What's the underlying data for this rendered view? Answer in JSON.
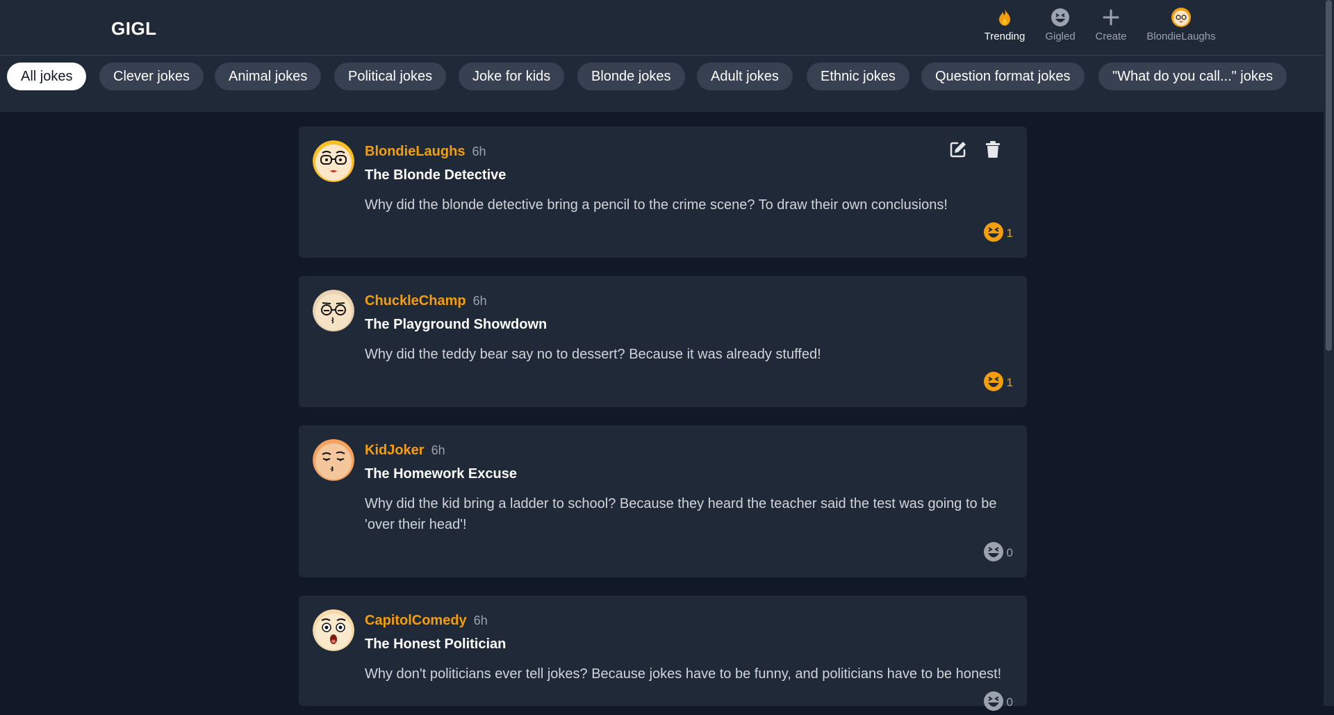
{
  "app": {
    "logo": "GIGL"
  },
  "nav": [
    {
      "label": "Trending",
      "icon": "flame-icon",
      "active": true
    },
    {
      "label": "Gigled",
      "icon": "laugh-face-icon",
      "active": false
    },
    {
      "label": "Create",
      "icon": "plus-icon",
      "active": false
    },
    {
      "label": "BlondieLaughs",
      "icon": "user-avatar-icon",
      "active": false
    }
  ],
  "filters": [
    {
      "label": "All jokes",
      "active": true
    },
    {
      "label": "Clever jokes"
    },
    {
      "label": "Animal jokes"
    },
    {
      "label": "Political jokes"
    },
    {
      "label": "Joke for kids"
    },
    {
      "label": "Blonde jokes"
    },
    {
      "label": "Adult jokes"
    },
    {
      "label": "Ethnic jokes"
    },
    {
      "label": "Question format jokes"
    },
    {
      "label": "\"What do you call...\" jokes"
    }
  ],
  "posts": [
    {
      "author": "BlondieLaughs",
      "time": "6h",
      "title": "The Blonde Detective",
      "body": "Why did the blonde detective bring a pencil to the crime scene? To draw their own conclusions!",
      "gigls": "1",
      "reacted": true,
      "owned": true,
      "avatar_icon": "woman-glasses-avatar-icon"
    },
    {
      "author": "ChuckleChamp",
      "time": "6h",
      "title": "The Playground Showdown",
      "body": "Why did the teddy bear say no to dessert? Because it was already stuffed!",
      "gigls": "1",
      "reacted": true,
      "owned": false,
      "avatar_icon": "man-glasses-avatar-icon"
    },
    {
      "author": "KidJoker",
      "time": "6h",
      "title": "The Homework Excuse",
      "body": "Why did the kid bring a ladder to school? Because they heard the teacher said the test was going to be 'over their head'!",
      "gigls": "0",
      "reacted": false,
      "owned": false,
      "avatar_icon": "smirk-avatar-icon"
    },
    {
      "author": "CapitolComedy",
      "time": "6h",
      "title": "The Honest Politician",
      "body": "Why don't politicians ever tell jokes? Because jokes have to be funny, and politicians have to be honest!",
      "gigls": "0",
      "reacted": false,
      "owned": false,
      "avatar_icon": "surprised-avatar-icon"
    }
  ],
  "colors": {
    "accent": "#f59e0b",
    "background": "#111827",
    "surface": "#1f2937",
    "chip": "#374151"
  }
}
